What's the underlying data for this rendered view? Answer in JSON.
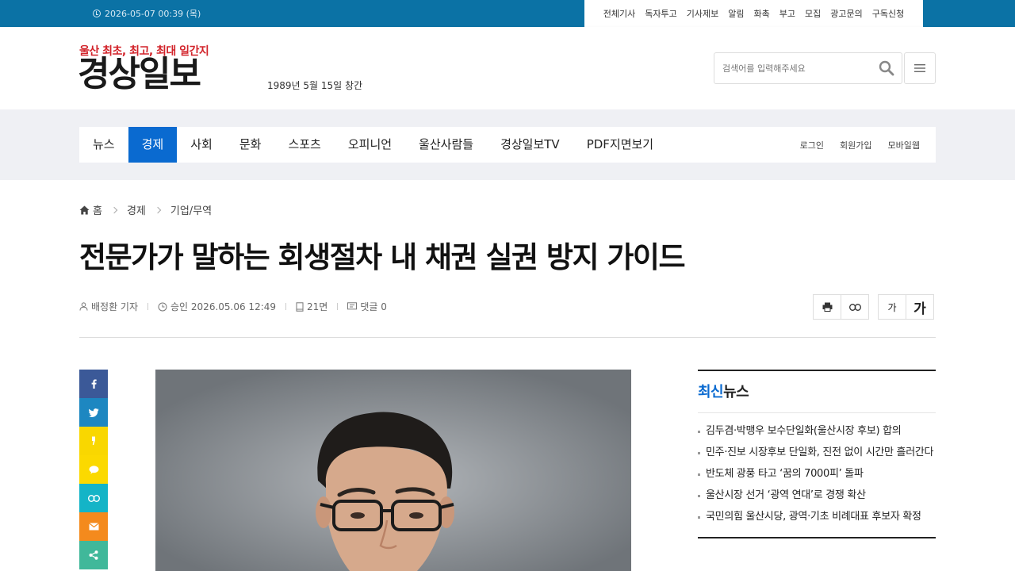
{
  "topbar": {
    "datetime": "2026-05-07 00:39 (목)",
    "links": [
      "전체기사",
      "독자투고",
      "기사제보",
      "알림",
      "화촉",
      "부고",
      "모집",
      "광고문의",
      "구독신청"
    ]
  },
  "header": {
    "slogan": "울산 최초, 최고, 최대 일간지",
    "logo": "경상일보",
    "founded": "1989년 5월 15일 창간",
    "search_placeholder": "검색어를 입력해주세요"
  },
  "nav": {
    "items": [
      "뉴스",
      "경제",
      "사회",
      "문화",
      "스포츠",
      "오피니언",
      "울산사람들",
      "경상일보TV",
      "PDF지면보기"
    ],
    "active_index": 1,
    "right": [
      "로그인",
      "회원가입",
      "모바일웹"
    ]
  },
  "breadcrumb": {
    "home": "홈",
    "level1": "경제",
    "level2": "기업/무역"
  },
  "article": {
    "title": "전문가가 말하는 회생절차 내 채권 실권 방지 가이드",
    "author": "배정환 기자",
    "approved": "승인 2026.05.06 12:49",
    "page": "21면",
    "comments": "댓글 0",
    "font_small": "가",
    "font_large": "가"
  },
  "share": [
    {
      "name": "facebook",
      "color": "#3b5998"
    },
    {
      "name": "twitter",
      "color": "#1d87c1"
    },
    {
      "name": "kakaostory",
      "color": "#f9d700"
    },
    {
      "name": "kakaotalk",
      "color": "#fbd900"
    },
    {
      "name": "link",
      "color": "#14b4c7"
    },
    {
      "name": "email",
      "color": "#f48a1d"
    },
    {
      "name": "share",
      "color": "#40b89a"
    }
  ],
  "latest": {
    "title_blue": "최신",
    "title_rest": "뉴스",
    "items": [
      "김두겸·박맹우 보수단일화(울산시장 후보) 합의",
      "민주·진보 시장후보 단일화, 진전 없이 시간만 흘러간다",
      "반도체 광풍 타고 ‘꿈의 7000피’ 돌파",
      "울산시장 선거 ‘광역 연대’로 경쟁 확산",
      "국민의힘 울산시당, 광역·기초 비례대표 후보자 확정"
    ]
  },
  "colors": {
    "topbar": "#0b72a5",
    "accent": "#0a6ad0",
    "slogan": "#d2232a"
  }
}
